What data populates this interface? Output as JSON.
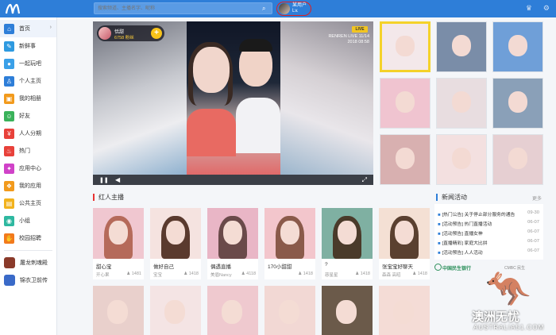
{
  "topbar": {
    "search_placeholder": "搜索频道、主播名字、昵称",
    "search_icon": "search-icon",
    "user_name": "某用户",
    "user_sub": "Lv.",
    "right_icons": [
      "crown-icon",
      "gear-icon"
    ]
  },
  "sidebar": {
    "items": [
      {
        "label": "首页",
        "icon": "home-icon",
        "color": "#2e7ed8",
        "glyph": "⌂",
        "active": true,
        "arrow": "›"
      },
      {
        "label": "新鲜事",
        "icon": "news-icon",
        "color": "#2e9ae0",
        "glyph": "✎",
        "active": false
      },
      {
        "label": "一起玩吧",
        "icon": "play-icon",
        "color": "#3aa0e8",
        "glyph": "●",
        "active": false
      },
      {
        "label": "个人主页",
        "icon": "person-icon",
        "color": "#2e7ed8",
        "glyph": "♙",
        "active": false
      },
      {
        "label": "我的相册",
        "icon": "album-icon",
        "color": "#f29a1c",
        "glyph": "▣",
        "active": false
      },
      {
        "label": "好友",
        "icon": "friends-icon",
        "color": "#3ab25a",
        "glyph": "☺",
        "active": false
      },
      {
        "label": "人人分期",
        "icon": "installment-icon",
        "color": "#e8413a",
        "glyph": "¥",
        "active": false
      },
      {
        "label": "热门",
        "icon": "hot-icon",
        "color": "#e8413a",
        "glyph": "♨",
        "active": false
      },
      {
        "label": "应用中心",
        "icon": "apps-icon",
        "color": "#d042c8",
        "glyph": "✦",
        "active": false
      },
      {
        "label": "我的应用",
        "icon": "myapps-icon",
        "color": "#f29a1c",
        "glyph": "❖",
        "active": false
      },
      {
        "label": "公共主页",
        "icon": "public-page-icon",
        "color": "#f2b21c",
        "glyph": "▤",
        "active": false
      },
      {
        "label": "小组",
        "icon": "group-icon",
        "color": "#2eb8a0",
        "glyph": "◉",
        "active": false
      },
      {
        "label": "校园招聘",
        "icon": "campus-icon",
        "color": "#f27a1c",
        "glyph": "✋",
        "active": false
      }
    ],
    "games": [
      {
        "label": "屠龙刺魂殿",
        "icon": "game-dragon-icon",
        "color": "#8a3a2a"
      },
      {
        "label": "锦衣卫前传",
        "icon": "game-guard-icon",
        "color": "#3a6ac8"
      }
    ]
  },
  "player": {
    "anchor_name": "恬甜",
    "anchor_fans": "6758 粉丝",
    "follow_glyph": "+",
    "live_badge": "LIVE",
    "live_line1": "RENREN LIVE 11/14",
    "live_line2": "2018 08:58",
    "play_glyph": "❚❚",
    "volume_glyph": "◀",
    "fullscreen_glyph": "⤢"
  },
  "sections": {
    "hot_anchors": "红人主播",
    "news": "新闻活动",
    "more": "更多"
  },
  "cards": [
    {
      "title": "甜心宝",
      "who": "开心果",
      "count": "1481",
      "bg": "#f0c7d0",
      "hair": "#b56a5a"
    },
    {
      "title": "做好自己",
      "who": "宝宝",
      "count": "1418",
      "bg": "#f5e3e0",
      "hair": "#5a3a2e"
    },
    {
      "title": "偶遇直播",
      "who": "美眉Nancy",
      "count": "4118",
      "bg": "#e9b6c6",
      "hair": "#6a4a4a"
    },
    {
      "title": "170小甜甜",
      "who": "",
      "count": "1418",
      "bg": "#f3c6cc",
      "hair": "#8a5a4a"
    },
    {
      "title": "?",
      "who": "慈星星",
      "count": "1418",
      "bg": "#7fb0a2",
      "hair": "#4a3a2a"
    },
    {
      "title": "张宝宝好聊天",
      "who": "森森 高昭",
      "count": "1418",
      "bg": "#f4e0d4",
      "hair": "#5a4030"
    }
  ],
  "news_items": [
    {
      "text": "[热门公告] 关于停止部分服务的通告",
      "date": "09-30"
    },
    {
      "text": "[活动预告] 热门直播活动",
      "date": "06-07"
    },
    {
      "text": "[活动预告] 直播女神",
      "date": "06-07"
    },
    {
      "text": "[直播精彩] 家庭大比拼",
      "date": "06-07"
    },
    {
      "text": "[活动预告] 人人活动",
      "date": "06-07"
    }
  ],
  "bank": {
    "name": "中国民生银行",
    "sub": "CMBC 民生"
  },
  "watermark": {
    "glyph": "🦘",
    "text": "澳洲无忧",
    "sub": "AUSTRALIA51.COM"
  }
}
